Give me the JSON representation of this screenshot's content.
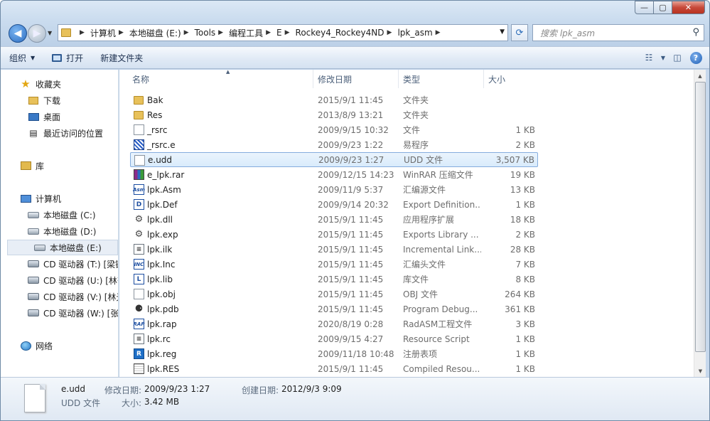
{
  "window": {
    "minimize_glyph": "—",
    "maximize_glyph": "▢",
    "close_glyph": "✕"
  },
  "address": {
    "crumbs": [
      "计算机",
      "本地磁盘 (E:)",
      "Tools",
      "编程工具",
      "E",
      "Rockey4_Rockey4ND",
      "lpk_asm"
    ],
    "search_placeholder": "搜索 lpk_asm"
  },
  "toolbar": {
    "organize": "组织",
    "open": "打开",
    "new_folder": "新建文件夹"
  },
  "nav": {
    "favorites": "收藏夹",
    "downloads": "下载",
    "desktop": "桌面",
    "recent": "最近访问的位置",
    "libraries": "库",
    "computer": "计算机",
    "drive_c": "本地磁盘 (C:)",
    "drive_d": "本地磁盘 (D:)",
    "drive_e": "本地磁盘 (E:)",
    "cd_t": "CD 驱动器 (T:) [梁键",
    "cd_u": "CD 驱动器 (U:) [林齐",
    "cd_v": "CD 驱动器 (V:) [林光",
    "cd_w": "CD 驱动器 (W:) [张钅",
    "network": "网络"
  },
  "columns": {
    "name": "名称",
    "date": "修改日期",
    "type": "类型",
    "size": "大小"
  },
  "files": [
    {
      "name": "Bak",
      "date": "2015/9/1 11:45",
      "type": "文件夹",
      "size": "",
      "icon": "folder-icon"
    },
    {
      "name": "Res",
      "date": "2013/8/9 13:21",
      "type": "文件夹",
      "size": "",
      "icon": "folder-icon"
    },
    {
      "name": "_rsrc",
      "date": "2009/9/15 10:32",
      "type": "文件",
      "size": "1 KB",
      "icon": "blank-file-icon"
    },
    {
      "name": "_rsrc.e",
      "date": "2009/9/23 1:22",
      "type": "易程序",
      "size": "2 KB",
      "icon": "e-program-icon"
    },
    {
      "name": "e.udd",
      "date": "2009/9/23 1:27",
      "type": "UDD 文件",
      "size": "3,507 KB",
      "icon": "blank-file-icon"
    },
    {
      "name": "e_lpk.rar",
      "date": "2009/12/15 14:23",
      "type": "WinRAR 压缩文件",
      "size": "19 KB",
      "icon": "winrar-icon"
    },
    {
      "name": "lpk.Asm",
      "date": "2009/11/9 5:37",
      "type": "汇编源文件",
      "size": "13 KB",
      "icon": "asm-file-icon"
    },
    {
      "name": "lpk.Def",
      "date": "2009/9/14 20:32",
      "type": "Export Definition...",
      "size": "1 KB",
      "icon": "def-file-icon"
    },
    {
      "name": "lpk.dll",
      "date": "2015/9/1 11:45",
      "type": "应用程序扩展",
      "size": "18 KB",
      "icon": "dll-gear-icon"
    },
    {
      "name": "lpk.exp",
      "date": "2015/9/1 11:45",
      "type": "Exports Library ...",
      "size": "2 KB",
      "icon": "exp-gear-icon"
    },
    {
      "name": "lpk.ilk",
      "date": "2015/9/1 11:45",
      "type": "Incremental Link...",
      "size": "28 KB",
      "icon": "ilk-file-icon"
    },
    {
      "name": "lpk.Inc",
      "date": "2015/9/1 11:45",
      "type": "汇编头文件",
      "size": "7 KB",
      "icon": "inc-file-icon"
    },
    {
      "name": "lpk.lib",
      "date": "2015/9/1 11:45",
      "type": "库文件",
      "size": "8 KB",
      "icon": "lib-file-icon"
    },
    {
      "name": "lpk.obj",
      "date": "2015/9/1 11:45",
      "type": "OBJ 文件",
      "size": "264 KB",
      "icon": "blank-file-icon"
    },
    {
      "name": "lpk.pdb",
      "date": "2015/9/1 11:45",
      "type": "Program Debug...",
      "size": "361 KB",
      "icon": "pdb-file-icon"
    },
    {
      "name": "lpk.rap",
      "date": "2020/8/19 0:28",
      "type": "RadASM工程文件",
      "size": "3 KB",
      "icon": "rap-file-icon"
    },
    {
      "name": "lpk.rc",
      "date": "2009/9/15 4:27",
      "type": "Resource Script",
      "size": "1 KB",
      "icon": "rc-file-icon"
    },
    {
      "name": "lpk.reg",
      "date": "2009/11/18 10:48",
      "type": "注册表项",
      "size": "1 KB",
      "icon": "registry-icon"
    },
    {
      "name": "lpk.RES",
      "date": "2015/9/1 11:45",
      "type": "Compiled Resou...",
      "size": "1 KB",
      "icon": "res-file-icon"
    }
  ],
  "details": {
    "filename": "e.udd",
    "filetype": "UDD 文件",
    "modified_label": "修改日期:",
    "modified_value": "2009/9/23 1:27",
    "size_label": "大小:",
    "size_value": "3.42 MB",
    "created_label": "创建日期:",
    "created_value": "2012/9/3 9:09"
  },
  "colors": {
    "selection_border": "#84acdd",
    "selection_fill": "#d9ebfb",
    "close_button": "#c7493a"
  }
}
